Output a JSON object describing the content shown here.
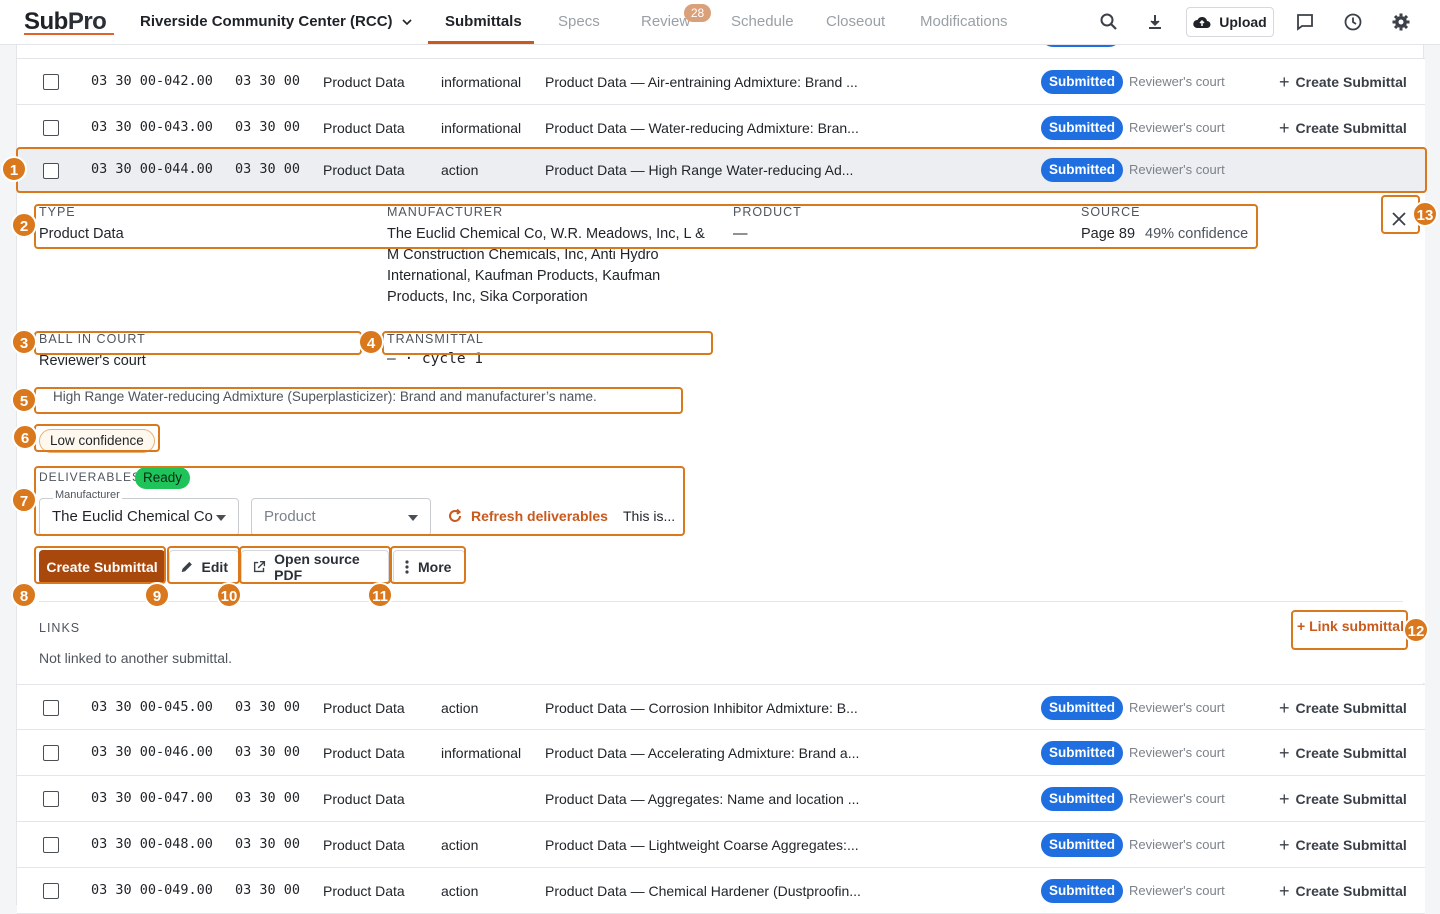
{
  "header": {
    "logo_sub": "Sub",
    "logo_pro": "Pro",
    "project": "Riverside Community Center (RCC)",
    "tabs": [
      "Submittals",
      "Specs",
      "Review",
      "Schedule",
      "Closeout",
      "Modifications"
    ],
    "review_count": "28",
    "upload_label": "Upload",
    "icons": [
      "search-icon",
      "download-icon",
      "upload-cloud-icon",
      "comment-icon",
      "history-icon",
      "settings-icon"
    ]
  },
  "rows_top": [
    {
      "id": "03 30 00-042.00",
      "section": "03 30 00",
      "type": "Product Data",
      "class": "informational",
      "title": "Product Data — Air-entraining Admixture: Brand ...",
      "status": "Submitted",
      "court": "Reviewer's court",
      "action": "Create Submittal"
    },
    {
      "id": "03 30 00-043.00",
      "section": "03 30 00",
      "type": "Product Data",
      "class": "informational",
      "title": "Product Data — Water-reducing Admixture: Bran...",
      "status": "Submitted",
      "court": "Reviewer's court",
      "action": "Create Submittal"
    },
    {
      "id": "03 30 00-044.00",
      "section": "03 30 00",
      "type": "Product Data",
      "class": "action",
      "title": "Product Data — High Range Water-reducing Ad...",
      "status": "Submitted",
      "court": "Reviewer's court",
      "action": ""
    }
  ],
  "detail": {
    "type_label": "TYPE",
    "type_value": "Product Data",
    "manufacturer_label": "MANUFACTURER",
    "manufacturer_lines": [
      "The Euclid Chemical Co, W.R. Meadows, Inc, L &",
      "M Construction Chemicals, Inc, Anti Hydro",
      "International, Kaufman Products, Kaufman",
      "Products, Inc, Sika Corporation"
    ],
    "product_label": "PRODUCT",
    "product_value": "—",
    "source_label": "SOURCE",
    "source_page": "Page 89",
    "source_confidence": "49% confidence",
    "ball_label": "BALL IN COURT",
    "ball_value": "Reviewer's court",
    "transmittal_label": "TRANSMITTAL",
    "transmittal_value": "— · cycle 1",
    "description": "High Range Water-reducing Admixture (Superplasticizer): Brand and manufacturer’s name.",
    "confidence_chip": "Low confidence",
    "deliverables_label": "DELIVERABLES",
    "deliverables_status": "Ready",
    "manufacturer_field_label": "Manufacturer",
    "manufacturer_selected": "The Euclid Chemical Co",
    "product_placeholder": "Product",
    "refresh_label": "Refresh deliverables",
    "this_is": "This is...",
    "create_label": "Create Submittal",
    "edit_label": "Edit",
    "open_pdf_label": "Open source PDF",
    "more_label": "More",
    "links_label": "LINKS",
    "links_empty": "Not linked to another submittal.",
    "link_submittal": "+ Link submittal"
  },
  "rows_bottom": [
    {
      "id": "03 30 00-045.00",
      "section": "03 30 00",
      "type": "Product Data",
      "class": "action",
      "title": "Product Data — Corrosion Inhibitor Admixture: B...",
      "status": "Submitted",
      "court": "Reviewer's court",
      "action": "Create Submittal"
    },
    {
      "id": "03 30 00-046.00",
      "section": "03 30 00",
      "type": "Product Data",
      "class": "informational",
      "title": "Product Data — Accelerating Admixture: Brand a...",
      "status": "Submitted",
      "court": "Reviewer's court",
      "action": "Create Submittal"
    },
    {
      "id": "03 30 00-047.00",
      "section": "03 30 00",
      "type": "Product Data",
      "class": "",
      "title": "Product Data — Aggregates: Name and location ...",
      "status": "Submitted",
      "court": "Reviewer's court",
      "action": "Create Submittal"
    },
    {
      "id": "03 30 00-048.00",
      "section": "03 30 00",
      "type": "Product Data",
      "class": "action",
      "title": "Product Data — Lightweight Coarse Aggregates:...",
      "status": "Submitted",
      "court": "Reviewer's court",
      "action": "Create Submittal"
    },
    {
      "id": "03 30 00-049.00",
      "section": "03 30 00",
      "type": "Product Data",
      "class": "action",
      "title": "Product Data — Chemical Hardener (Dustproofin...",
      "status": "Submitted",
      "court": "Reviewer's court",
      "action": "Create Submittal"
    }
  ],
  "markers": [
    "1",
    "2",
    "3",
    "4",
    "5",
    "6",
    "7",
    "8",
    "9",
    "10",
    "11",
    "12",
    "13"
  ],
  "colors": {
    "accent": "#c85a1e",
    "status_blue": "#1f6fe0",
    "annotation": "#d9781c",
    "ready_green": "#1ec45a"
  }
}
